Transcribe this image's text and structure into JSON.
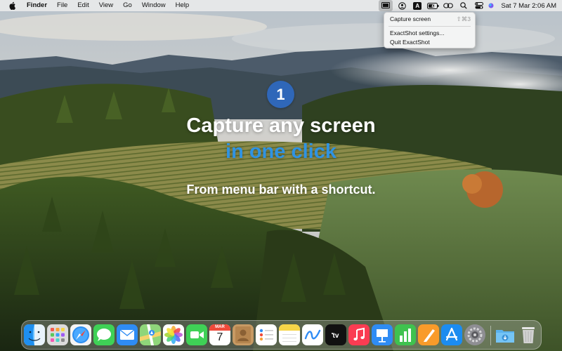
{
  "menubar": {
    "apple_icon": "apple-logo-icon",
    "app_name": "Finder",
    "items": [
      "File",
      "Edit",
      "View",
      "Go",
      "Window",
      "Help"
    ],
    "status_icons": [
      "exactshot-icon",
      "user-circle-icon",
      "input-source-icon",
      "battery-icon",
      "link-icon",
      "search-icon",
      "control-center-icon",
      "siri-icon"
    ],
    "input_source_label": "A",
    "clock": "Sat 7 Mar  2:06 AM"
  },
  "dropdown": {
    "items": [
      {
        "label": "Capture screen",
        "shortcut": "⇧⌘3"
      },
      {
        "label": "ExactShot settings...",
        "shortcut": ""
      },
      {
        "label": "Quit ExactShot",
        "shortcut": ""
      }
    ]
  },
  "hero": {
    "step_number": "1",
    "headline_line1": "Capture any screen",
    "headline_line2": "in one click",
    "subtitle": "From menu bar with a shortcut."
  },
  "dock": {
    "calendar": {
      "month": "MAR",
      "day": "7"
    },
    "apps": [
      "finder-icon",
      "launchpad-icon",
      "safari-icon",
      "messages-icon",
      "mail-icon",
      "maps-icon",
      "photos-icon",
      "facetime-icon",
      "calendar-icon",
      "contacts-icon",
      "reminders-icon",
      "notes-icon",
      "freeform-icon",
      "apple-tv-icon",
      "music-icon",
      "keynote-icon",
      "numbers-icon",
      "pages-icon",
      "app-store-icon",
      "system-settings-icon",
      "downloads-folder-icon",
      "trash-icon"
    ]
  },
  "colors": {
    "accent_blue": "#2f93e2",
    "badge_blue": "#2f67b9"
  }
}
